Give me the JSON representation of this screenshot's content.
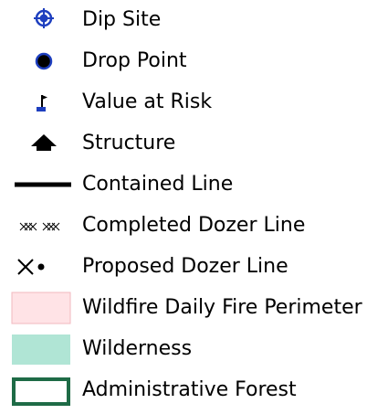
{
  "legend": {
    "items": [
      {
        "label": "Dip Site",
        "symbol": "dip-site-icon",
        "color": "#1e3fbf"
      },
      {
        "label": "Drop Point",
        "symbol": "drop-point-icon",
        "color": "#000000",
        "outline": "#1e3fbf"
      },
      {
        "label": "Value at Risk",
        "symbol": "value-at-risk-flag-icon",
        "color": "#000000",
        "accent": "#1e3fbf"
      },
      {
        "label": "Structure",
        "symbol": "structure-house-icon",
        "color": "#000000"
      },
      {
        "label": "Contained Line",
        "symbol": "contained-line-icon",
        "color": "#000000"
      },
      {
        "label": "Completed Dozer Line",
        "symbol": "completed-dozer-line-icon",
        "color": "#000000"
      },
      {
        "label": "Proposed Dozer Line",
        "symbol": "proposed-dozer-line-icon",
        "color": "#000000"
      },
      {
        "label": "Wildfire Daily Fire Perimeter",
        "symbol": "fire-perimeter-swatch-icon",
        "fill": "#ffe3e6",
        "stroke": "#f2b8bf"
      },
      {
        "label": "Wilderness",
        "symbol": "wilderness-swatch-icon",
        "fill": "#b0e5d5"
      },
      {
        "label": "Administrative Forest",
        "symbol": "administrative-forest-swatch-icon",
        "stroke": "#1e6b46"
      }
    ]
  }
}
